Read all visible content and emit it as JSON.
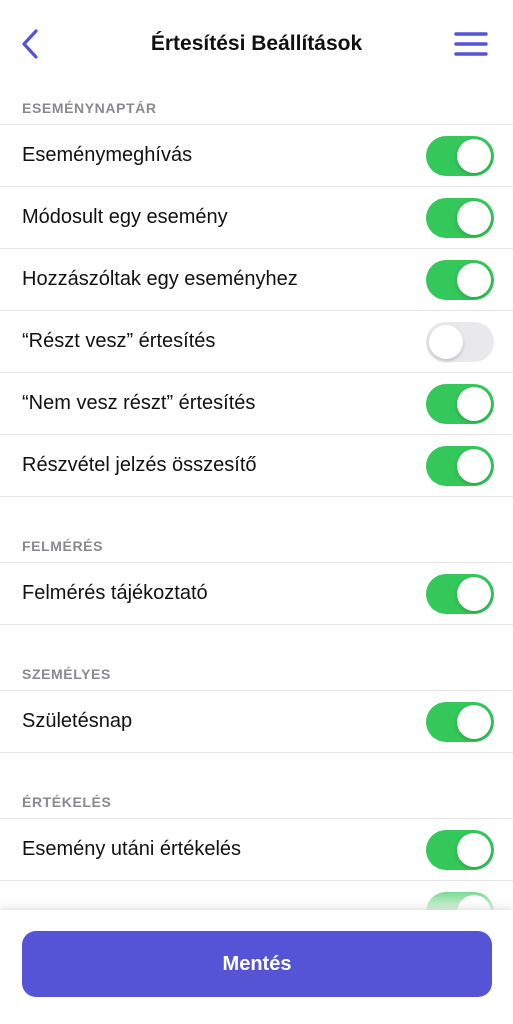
{
  "header": {
    "title": "Értesítési Beállítások",
    "back_icon": "chevron-left-icon",
    "menu_icon": "hamburger-menu-icon"
  },
  "colors": {
    "accent": "#5553d6",
    "toggle_on": "#34c759",
    "toggle_off": "#e9e9eb",
    "section_header": "#8a8a8e"
  },
  "sections": [
    {
      "title": "ESEMÉNYNAPTÁR",
      "items": [
        {
          "label": "Eseménymeghívás",
          "on": true
        },
        {
          "label": "Módosult egy esemény",
          "on": true
        },
        {
          "label": "Hozzászóltak egy eseményhez",
          "on": true
        },
        {
          "label": "“Részt vesz” értesítés",
          "on": false
        },
        {
          "label": "“Nem vesz részt” értesítés",
          "on": true
        },
        {
          "label": "Részvétel jelzés összesítő",
          "on": true
        }
      ]
    },
    {
      "title": "FELMÉRÉS",
      "items": [
        {
          "label": "Felmérés tájékoztató",
          "on": true
        }
      ]
    },
    {
      "title": "SZEMÉLYES",
      "items": [
        {
          "label": "Születésnap",
          "on": true
        }
      ]
    },
    {
      "title": "ÉRTÉKELÉS",
      "items": [
        {
          "label": "Esemény utáni értékelés",
          "on": true
        },
        {
          "label": "",
          "on": true
        }
      ]
    }
  ],
  "footer": {
    "save_label": "Mentés"
  }
}
